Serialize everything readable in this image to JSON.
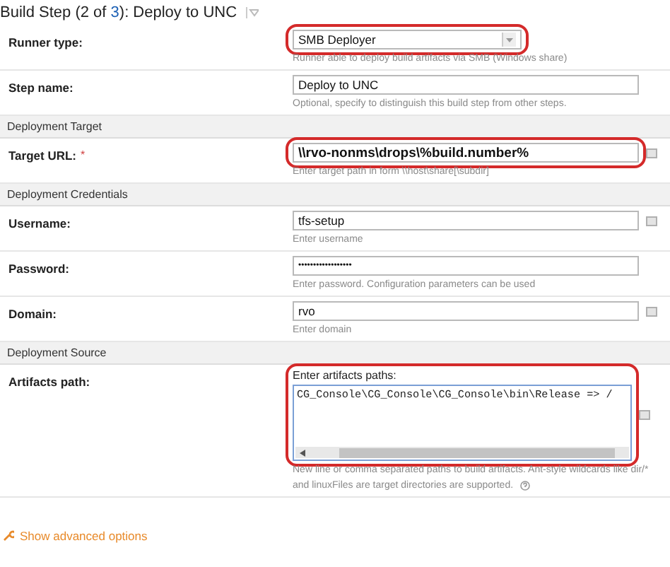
{
  "title": {
    "prefix": "Build Step (2 of ",
    "link": "3",
    "suffix": "): Deploy to UNC"
  },
  "rows": [
    {
      "kind": "select",
      "label": "Runner type:",
      "value": "SMB Deployer",
      "help": [
        "Runner able to deploy build artifacts via SMB (Windows share)"
      ],
      "highlighted": true,
      "param_icon": false
    },
    {
      "kind": "text",
      "label": "Step name:",
      "value": "Deploy to UNC",
      "help": [
        "Optional, specify to distinguish this build step from other steps."
      ],
      "highlighted": false,
      "param_icon": false
    },
    {
      "kind": "header",
      "label": "Deployment Target"
    },
    {
      "kind": "url",
      "label": "Target URL:",
      "required_mark": "*",
      "value": "\\\\rvo-nonms\\drops\\%build.number%",
      "help": [
        "Enter target path in form \\\\host\\share[\\subdir]"
      ],
      "highlighted": true,
      "param_icon": true
    },
    {
      "kind": "header",
      "label": "Deployment Credentials"
    },
    {
      "kind": "text",
      "label": "Username:",
      "value": "tfs-setup",
      "help": [
        "Enter username"
      ],
      "highlighted": false,
      "param_icon": true
    },
    {
      "kind": "password",
      "label": "Password:",
      "value": "••••••••••••••••••",
      "help": [
        "Enter password. Configuration parameters can be used"
      ],
      "highlighted": false,
      "param_icon": false
    },
    {
      "kind": "text",
      "label": "Domain:",
      "value": "rvo",
      "help": [
        "Enter domain"
      ],
      "highlighted": false,
      "param_icon": true
    },
    {
      "kind": "header",
      "label": "Deployment Source"
    },
    {
      "kind": "textarea",
      "label": "Artifacts path:",
      "caption": "Enter artifacts paths:",
      "value": "CG_Console\\CG_Console\\CG_Console\\bin\\Release  => /",
      "help": [
        "New line or comma separated paths to build artifacts. Ant-style wildcards like dir/*",
        "and linuxFiles are target directories are supported."
      ],
      "help_icon": true,
      "highlighted": true,
      "param_icon": true
    }
  ],
  "advanced_link": "Show advanced options"
}
